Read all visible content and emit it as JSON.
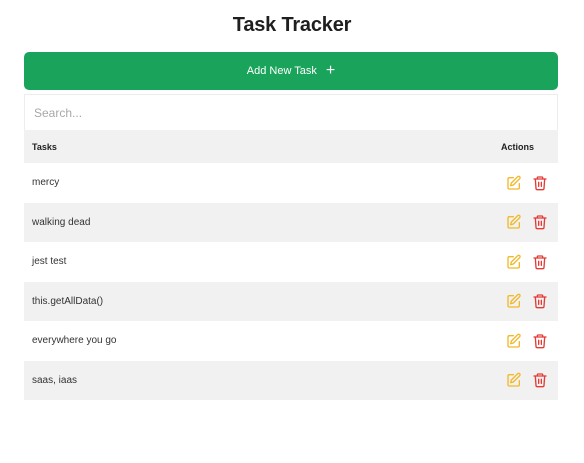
{
  "page": {
    "title": "Task Tracker"
  },
  "add_button": {
    "label": "Add New Task",
    "icon": "plus-icon",
    "color": "#1aa35a"
  },
  "search": {
    "placeholder": "Search...",
    "value": ""
  },
  "table": {
    "headers": {
      "task": "Tasks",
      "actions": "Actions"
    },
    "rows": [
      {
        "task": "mercy"
      },
      {
        "task": "walking dead"
      },
      {
        "task": "jest test"
      },
      {
        "task": "this.getAllData()"
      },
      {
        "task": "everywhere you go"
      },
      {
        "task": "saas, iaas"
      }
    ],
    "edit_icon": {
      "name": "edit-icon",
      "color": "#f2b827"
    },
    "delete_icon": {
      "name": "trash-icon",
      "color": "#e53935"
    }
  }
}
